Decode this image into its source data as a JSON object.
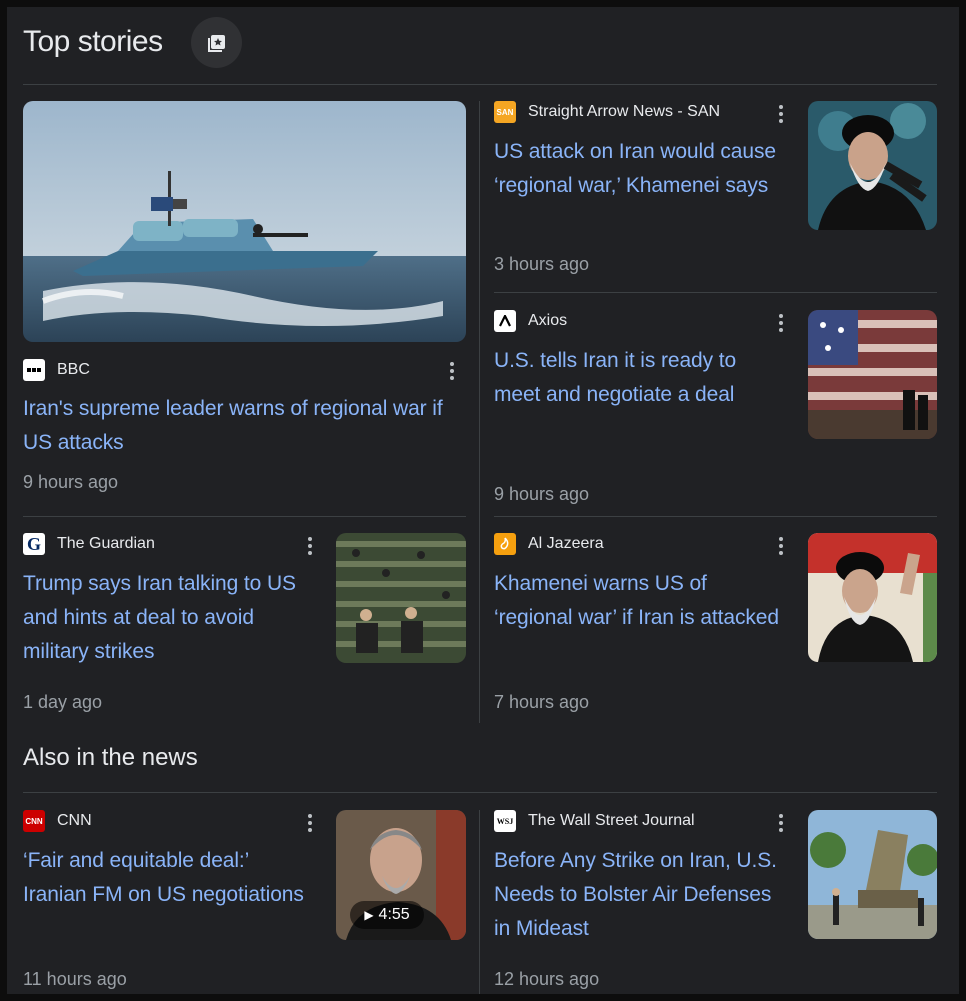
{
  "header": {
    "title": "Top stories",
    "badge_icon": "news-bookmark-icon"
  },
  "stories": [
    {
      "source": "BBC",
      "headline": "Iran's supreme leader warns of regional war if US attacks",
      "time": "9 hours ago"
    },
    {
      "source": "Straight Arrow News - SAN",
      "logo_text": "SAN",
      "headline": "US attack on Iran would cause ‘regional war,’ Khamenei says",
      "time": "3 hours ago"
    },
    {
      "source": "Axios",
      "headline": "U.S. tells Iran it is ready to meet and negotiate a deal",
      "time": "9 hours ago"
    },
    {
      "source": "The Guardian",
      "headline": "Trump says Iran talking to US and hints at deal to avoid military strikes",
      "time": "1 day ago"
    },
    {
      "source": "Al Jazeera",
      "headline": "Khamenei warns US of ‘regional war’ if Iran is attacked",
      "time": "7 hours ago"
    }
  ],
  "also": {
    "title": "Also in the news",
    "items": [
      {
        "source": "CNN",
        "logo_text": "CNN",
        "headline": "‘Fair and equitable deal:’ Iranian FM on US negotiations",
        "time": "11 hours ago",
        "video_duration": "4:55"
      },
      {
        "source": "The Wall Street Journal",
        "logo_text": "WSJ",
        "headline": "Before Any Strike on Iran, U.S. Needs to Bolster Air Defenses in Mideast",
        "time": "12 hours ago"
      }
    ]
  },
  "colors": {
    "background": "#202124",
    "headline": "#8ab4f8",
    "text": "#e8eaed",
    "muted": "#9aa0a6",
    "divider": "#3c4043"
  }
}
